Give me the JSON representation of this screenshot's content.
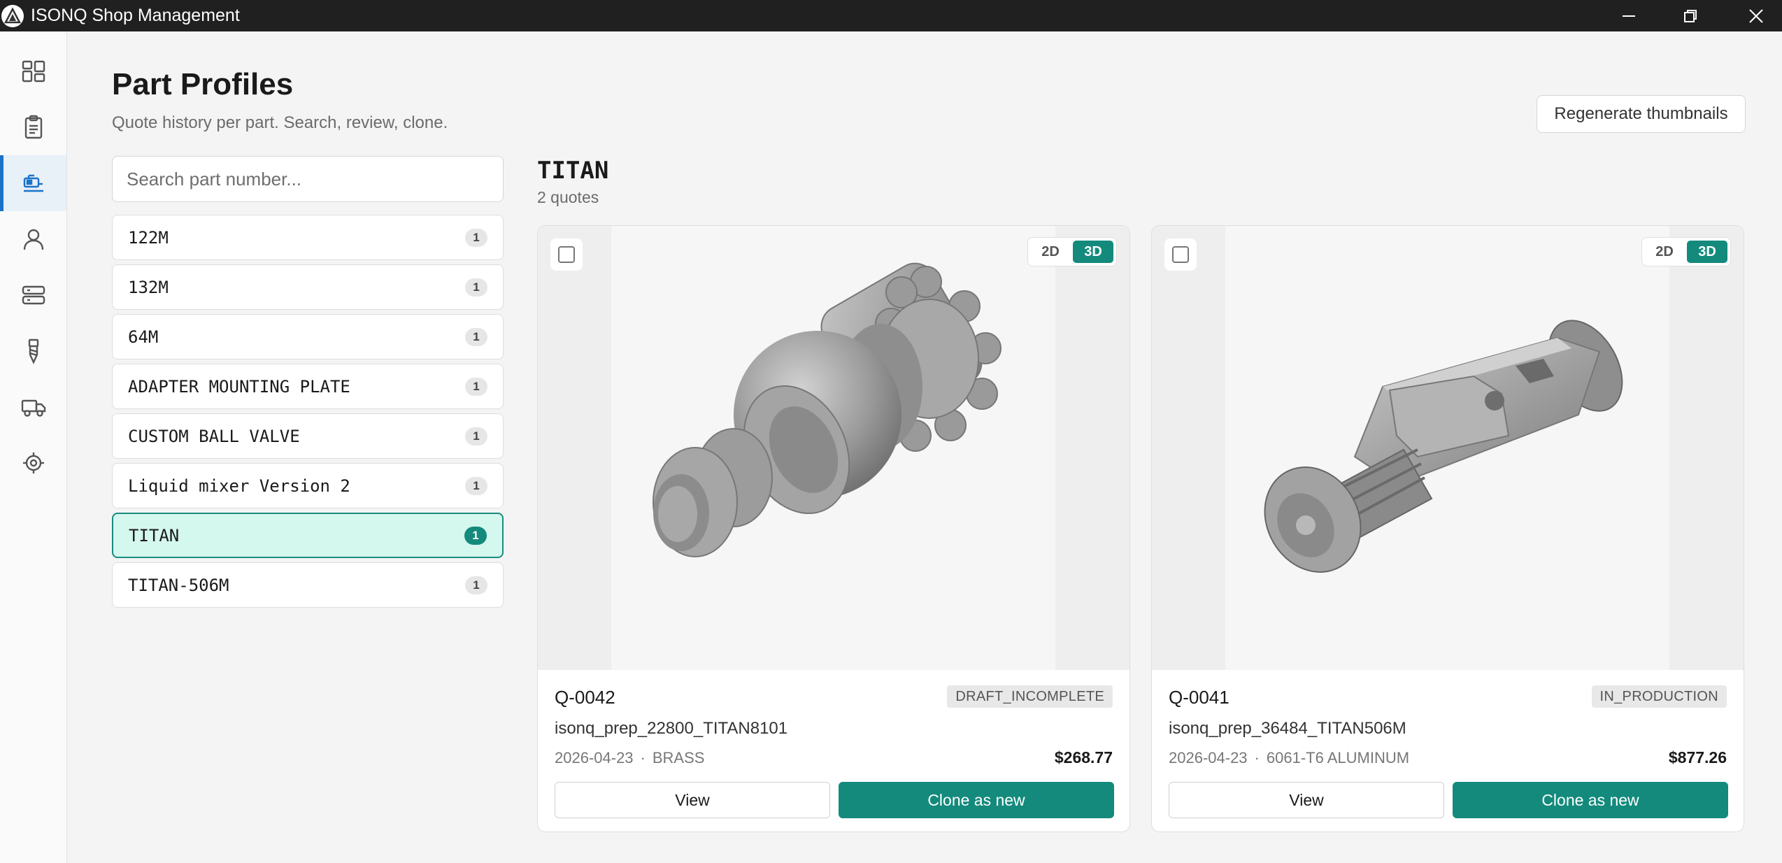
{
  "window": {
    "title": "ISONQ Shop Management"
  },
  "sidebar": {
    "items": [
      {
        "icon": "dashboard-icon",
        "active": false
      },
      {
        "icon": "clipboard-icon",
        "active": false
      },
      {
        "icon": "part-profiles-icon",
        "active": true
      },
      {
        "icon": "user-icon",
        "active": false
      },
      {
        "icon": "server-icon",
        "active": false
      },
      {
        "icon": "tool-icon",
        "active": false
      },
      {
        "icon": "truck-icon",
        "active": false
      },
      {
        "icon": "target-icon",
        "active": false
      }
    ]
  },
  "header": {
    "title": "Part Profiles",
    "subtitle": "Quote history per part. Search, review, clone.",
    "regenerate_label": "Regenerate thumbnails"
  },
  "search": {
    "placeholder": "Search part number...",
    "value": ""
  },
  "parts": [
    {
      "name": "122M",
      "count": "1",
      "selected": false
    },
    {
      "name": "132M",
      "count": "1",
      "selected": false
    },
    {
      "name": "64M",
      "count": "1",
      "selected": false
    },
    {
      "name": "ADAPTER MOUNTING PLATE",
      "count": "1",
      "selected": false
    },
    {
      "name": "CUSTOM BALL VALVE",
      "count": "1",
      "selected": false
    },
    {
      "name": "Liquid mixer Version 2",
      "count": "1",
      "selected": false
    },
    {
      "name": "TITAN",
      "count": "1",
      "selected": true
    },
    {
      "name": "TITAN-506M",
      "count": "1",
      "selected": false
    }
  ],
  "detail": {
    "title": "TITAN",
    "subtitle": "2 quotes"
  },
  "quotes": [
    {
      "id": "Q-0042",
      "status": "DRAFT_INCOMPLETE",
      "filename": "isonq_prep_22800_TITAN8101",
      "date": "2026-04-23",
      "separator": "·",
      "material": "BRASS",
      "price": "$268.77",
      "toggle_2d": "2D",
      "toggle_3d": "3D",
      "view_label": "View",
      "clone_label": "Clone as new"
    },
    {
      "id": "Q-0041",
      "status": "IN_PRODUCTION",
      "filename": "isonq_prep_36484_TITAN506M",
      "date": "2026-04-23",
      "separator": "·",
      "material": "6061-T6 ALUMINUM",
      "price": "$877.26",
      "toggle_2d": "2D",
      "toggle_3d": "3D",
      "view_label": "View",
      "clone_label": "Clone as new"
    }
  ],
  "colors": {
    "accent": "#138a7c",
    "selected_bg": "#d4f7ee",
    "titlebar": "#202020",
    "nav_active": "#1a73c8"
  }
}
